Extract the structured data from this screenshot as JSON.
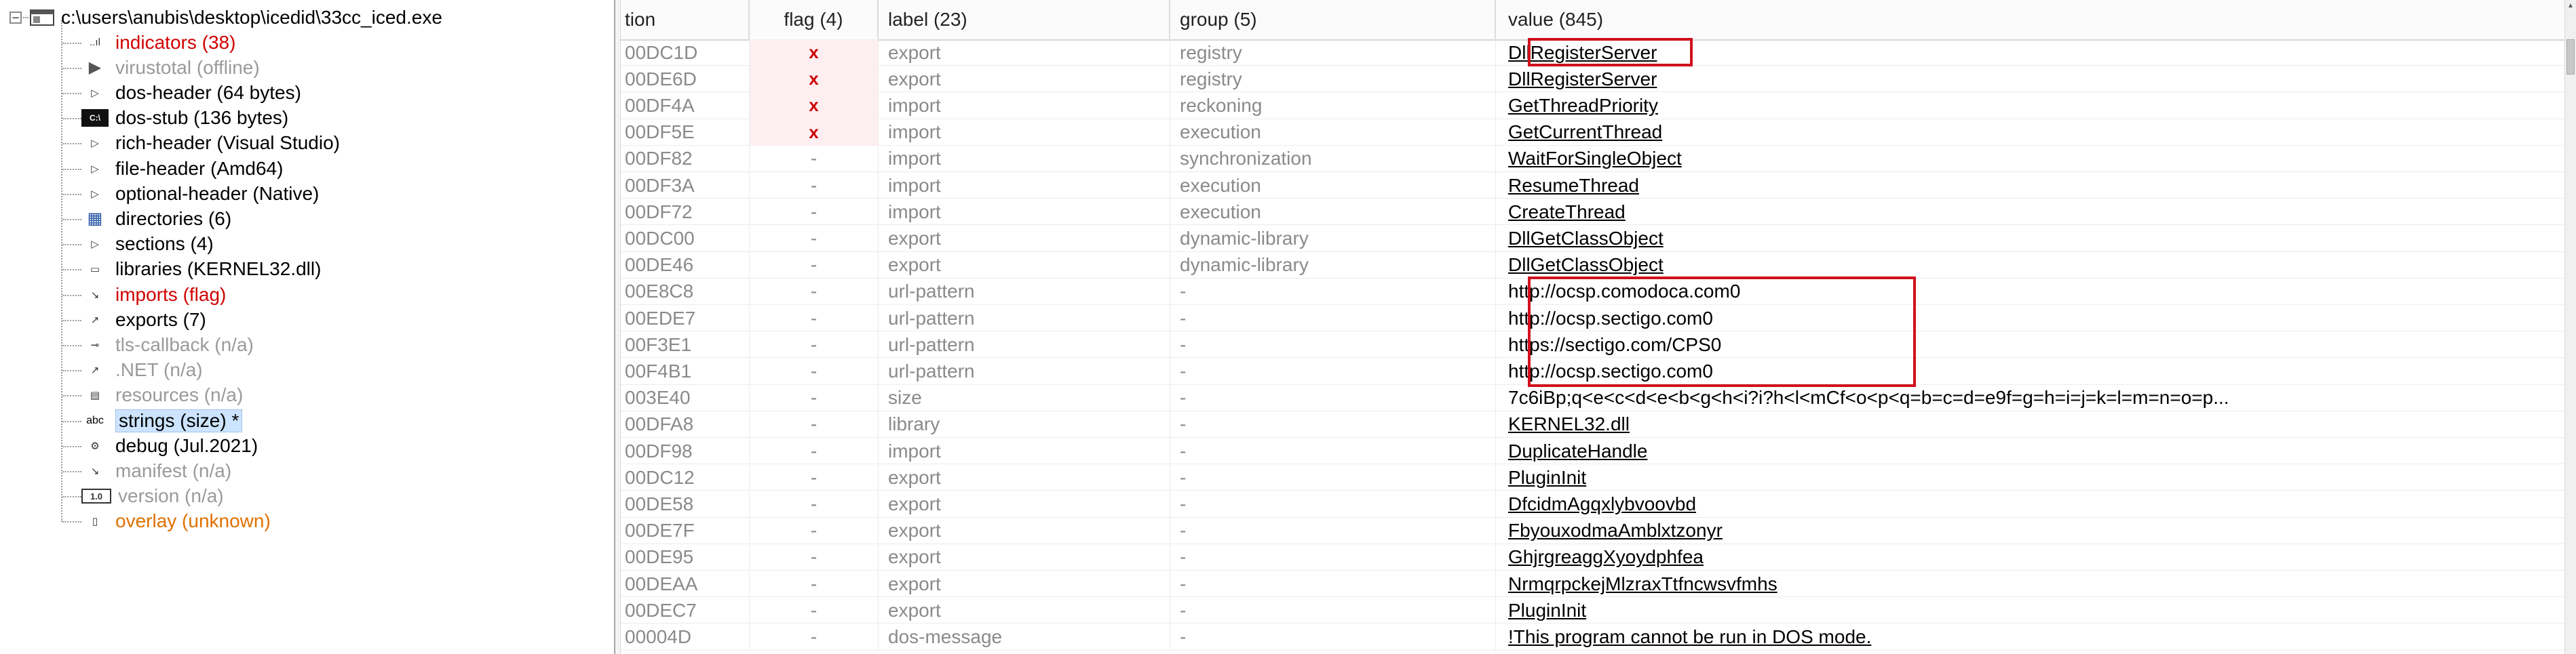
{
  "tree": {
    "root_label": "c:\\users\\anubis\\desktop\\icedid\\33cc_iced.exe",
    "items": [
      {
        "label": "indicators (38)",
        "style": "red",
        "icon": "indicators-icon",
        "glyph": "..ıl"
      },
      {
        "label": "virustotal (offline)",
        "style": "gray",
        "icon": "virustotal-icon",
        "glyph": "▶"
      },
      {
        "label": "dos-header (64 bytes)",
        "style": "black",
        "icon": "expand-arrow-icon",
        "glyph": "▷"
      },
      {
        "label": "dos-stub (136 bytes)",
        "style": "black",
        "icon": "dos-stub-icon",
        "glyph": "C:\\"
      },
      {
        "label": "rich-header (Visual Studio)",
        "style": "black",
        "icon": "expand-arrow-icon",
        "glyph": "▷"
      },
      {
        "label": "file-header (Amd64)",
        "style": "black",
        "icon": "expand-arrow-icon",
        "glyph": "▷"
      },
      {
        "label": "optional-header (Native)",
        "style": "black",
        "icon": "expand-arrow-icon",
        "glyph": "▷"
      },
      {
        "label": "directories (6)",
        "style": "black",
        "icon": "directories-icon",
        "glyph": "▦"
      },
      {
        "label": "sections (4)",
        "style": "black",
        "icon": "expand-arrow-icon",
        "glyph": "▷"
      },
      {
        "label": "libraries (KERNEL32.dll)",
        "style": "black",
        "icon": "libraries-icon",
        "glyph": "▭"
      },
      {
        "label": "imports (flag)",
        "style": "red",
        "icon": "imports-icon",
        "glyph": "↘"
      },
      {
        "label": "exports (7)",
        "style": "black",
        "icon": "exports-icon",
        "glyph": "↗"
      },
      {
        "label": "tls-callback (n/a)",
        "style": "gray",
        "icon": "tls-callback-icon",
        "glyph": "⊸"
      },
      {
        "label": ".NET (n/a)",
        "style": "gray",
        "icon": "dotnet-icon",
        "glyph": "↗"
      },
      {
        "label": "resources (n/a)",
        "style": "gray",
        "icon": "resources-icon",
        "glyph": "▤"
      },
      {
        "label": "strings (size) *",
        "style": "selected",
        "icon": "strings-icon",
        "glyph": "abc"
      },
      {
        "label": "debug (Jul.2021)",
        "style": "black",
        "icon": "debug-icon",
        "glyph": "⚙"
      },
      {
        "label": "manifest (n/a)",
        "style": "gray",
        "icon": "manifest-icon",
        "glyph": "↘"
      },
      {
        "label": "version (n/a)",
        "style": "gray",
        "icon": "version-icon",
        "glyph": "1.0"
      },
      {
        "label": "overlay (unknown)",
        "style": "orange",
        "icon": "overlay-icon",
        "glyph": "▯"
      }
    ]
  },
  "table": {
    "headers": {
      "offset": "tion",
      "flag": "flag (4)",
      "label": "label (23)",
      "group": "group (5)",
      "value": "value (845)"
    },
    "rows": [
      {
        "offset": "00DC1D",
        "flag": "x",
        "label": "export",
        "group": "registry",
        "value": "DllRegisterServer",
        "link": true
      },
      {
        "offset": "00DE6D",
        "flag": "x",
        "label": "export",
        "group": "registry",
        "value": "DllRegisterServer",
        "link": true
      },
      {
        "offset": "00DF4A",
        "flag": "x",
        "label": "import",
        "group": "reckoning",
        "value": "GetThreadPriority",
        "link": true
      },
      {
        "offset": "00DF5E",
        "flag": "x",
        "label": "import",
        "group": "execution",
        "value": "GetCurrentThread",
        "link": true
      },
      {
        "offset": "00DF82",
        "flag": "-",
        "label": "import",
        "group": "synchronization",
        "value": "WaitForSingleObject",
        "link": true
      },
      {
        "offset": "00DF3A",
        "flag": "-",
        "label": "import",
        "group": "execution",
        "value": "ResumeThread",
        "link": true
      },
      {
        "offset": "00DF72",
        "flag": "-",
        "label": "import",
        "group": "execution",
        "value": "CreateThread",
        "link": true
      },
      {
        "offset": "00DC00",
        "flag": "-",
        "label": "export",
        "group": "dynamic-library",
        "value": "DllGetClassObject",
        "link": true
      },
      {
        "offset": "00DE46",
        "flag": "-",
        "label": "export",
        "group": "dynamic-library",
        "value": "DllGetClassObject",
        "link": true
      },
      {
        "offset": "00E8C8",
        "flag": "-",
        "label": "url-pattern",
        "group": "-",
        "value": "http://ocsp.comodoca.com0",
        "link": false
      },
      {
        "offset": "00EDE7",
        "flag": "-",
        "label": "url-pattern",
        "group": "-",
        "value": "http://ocsp.sectigo.com0",
        "link": false
      },
      {
        "offset": "00F3E1",
        "flag": "-",
        "label": "url-pattern",
        "group": "-",
        "value": "https://sectigo.com/CPS0",
        "link": false
      },
      {
        "offset": "00F4B1",
        "flag": "-",
        "label": "url-pattern",
        "group": "-",
        "value": "http://ocsp.sectigo.com0",
        "link": false
      },
      {
        "offset": "003E40",
        "flag": "-",
        "label": "size",
        "group": "-",
        "value": "7c6iBp;q<e<c<d<e<b<g<h<i?i?h<l<mCf<o<p<q=b=c=d=e9f=g=h=i=j=k=l=m=n=o=p...",
        "link": false
      },
      {
        "offset": "00DFA8",
        "flag": "-",
        "label": "library",
        "group": "-",
        "value": "KERNEL32.dll",
        "link": true
      },
      {
        "offset": "00DF98",
        "flag": "-",
        "label": "import",
        "group": "-",
        "value": "DuplicateHandle",
        "link": true
      },
      {
        "offset": "00DC12",
        "flag": "-",
        "label": "export",
        "group": "-",
        "value": "PluginInit",
        "link": true
      },
      {
        "offset": "00DE58",
        "flag": "-",
        "label": "export",
        "group": "-",
        "value": "DfcidmAgqxlybvoovbd",
        "link": true
      },
      {
        "offset": "00DE7F",
        "flag": "-",
        "label": "export",
        "group": "-",
        "value": "FbyouxodmaAmblxtzonyr",
        "link": true
      },
      {
        "offset": "00DE95",
        "flag": "-",
        "label": "export",
        "group": "-",
        "value": "GhjrgreaggXyoydphfea",
        "link": true
      },
      {
        "offset": "00DEAA",
        "flag": "-",
        "label": "export",
        "group": "-",
        "value": "NrmqrpckejMlzraxTtfncwsvfmhs",
        "link": true
      },
      {
        "offset": "00DEC7",
        "flag": "-",
        "label": "export",
        "group": "-",
        "value": "PluginInit",
        "link": true
      },
      {
        "offset": "00004D",
        "flag": "-",
        "label": "dos-message",
        "group": "-",
        "value": "!This program cannot be run in DOS mode.",
        "link": true
      }
    ]
  },
  "colors": {
    "highlight_box": "#d0101c",
    "flag_bg": "#fdeef0",
    "flag_x": "#cc0000",
    "indicator_red": "#d10000",
    "overlay_orange": "#e07000",
    "selection": "#cce4ff"
  }
}
